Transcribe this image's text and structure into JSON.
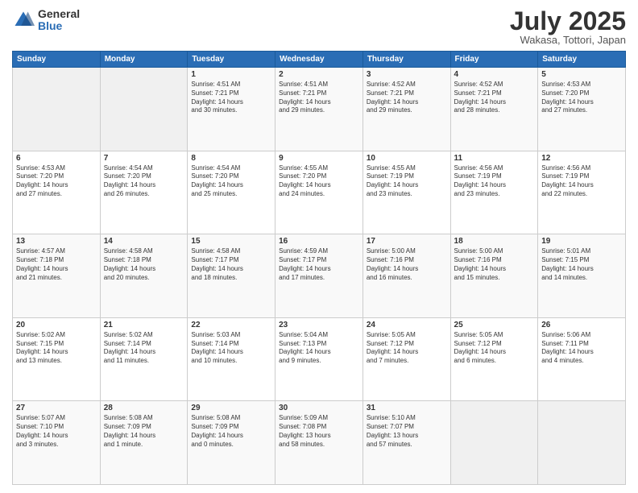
{
  "header": {
    "logo_general": "General",
    "logo_blue": "Blue",
    "month_title": "July 2025",
    "location": "Wakasa, Tottori, Japan"
  },
  "weekdays": [
    "Sunday",
    "Monday",
    "Tuesday",
    "Wednesday",
    "Thursday",
    "Friday",
    "Saturday"
  ],
  "weeks": [
    [
      {
        "day": "",
        "info": ""
      },
      {
        "day": "",
        "info": ""
      },
      {
        "day": "1",
        "info": "Sunrise: 4:51 AM\nSunset: 7:21 PM\nDaylight: 14 hours\nand 30 minutes."
      },
      {
        "day": "2",
        "info": "Sunrise: 4:51 AM\nSunset: 7:21 PM\nDaylight: 14 hours\nand 29 minutes."
      },
      {
        "day": "3",
        "info": "Sunrise: 4:52 AM\nSunset: 7:21 PM\nDaylight: 14 hours\nand 29 minutes."
      },
      {
        "day": "4",
        "info": "Sunrise: 4:52 AM\nSunset: 7:21 PM\nDaylight: 14 hours\nand 28 minutes."
      },
      {
        "day": "5",
        "info": "Sunrise: 4:53 AM\nSunset: 7:20 PM\nDaylight: 14 hours\nand 27 minutes."
      }
    ],
    [
      {
        "day": "6",
        "info": "Sunrise: 4:53 AM\nSunset: 7:20 PM\nDaylight: 14 hours\nand 27 minutes."
      },
      {
        "day": "7",
        "info": "Sunrise: 4:54 AM\nSunset: 7:20 PM\nDaylight: 14 hours\nand 26 minutes."
      },
      {
        "day": "8",
        "info": "Sunrise: 4:54 AM\nSunset: 7:20 PM\nDaylight: 14 hours\nand 25 minutes."
      },
      {
        "day": "9",
        "info": "Sunrise: 4:55 AM\nSunset: 7:20 PM\nDaylight: 14 hours\nand 24 minutes."
      },
      {
        "day": "10",
        "info": "Sunrise: 4:55 AM\nSunset: 7:19 PM\nDaylight: 14 hours\nand 23 minutes."
      },
      {
        "day": "11",
        "info": "Sunrise: 4:56 AM\nSunset: 7:19 PM\nDaylight: 14 hours\nand 23 minutes."
      },
      {
        "day": "12",
        "info": "Sunrise: 4:56 AM\nSunset: 7:19 PM\nDaylight: 14 hours\nand 22 minutes."
      }
    ],
    [
      {
        "day": "13",
        "info": "Sunrise: 4:57 AM\nSunset: 7:18 PM\nDaylight: 14 hours\nand 21 minutes."
      },
      {
        "day": "14",
        "info": "Sunrise: 4:58 AM\nSunset: 7:18 PM\nDaylight: 14 hours\nand 20 minutes."
      },
      {
        "day": "15",
        "info": "Sunrise: 4:58 AM\nSunset: 7:17 PM\nDaylight: 14 hours\nand 18 minutes."
      },
      {
        "day": "16",
        "info": "Sunrise: 4:59 AM\nSunset: 7:17 PM\nDaylight: 14 hours\nand 17 minutes."
      },
      {
        "day": "17",
        "info": "Sunrise: 5:00 AM\nSunset: 7:16 PM\nDaylight: 14 hours\nand 16 minutes."
      },
      {
        "day": "18",
        "info": "Sunrise: 5:00 AM\nSunset: 7:16 PM\nDaylight: 14 hours\nand 15 minutes."
      },
      {
        "day": "19",
        "info": "Sunrise: 5:01 AM\nSunset: 7:15 PM\nDaylight: 14 hours\nand 14 minutes."
      }
    ],
    [
      {
        "day": "20",
        "info": "Sunrise: 5:02 AM\nSunset: 7:15 PM\nDaylight: 14 hours\nand 13 minutes."
      },
      {
        "day": "21",
        "info": "Sunrise: 5:02 AM\nSunset: 7:14 PM\nDaylight: 14 hours\nand 11 minutes."
      },
      {
        "day": "22",
        "info": "Sunrise: 5:03 AM\nSunset: 7:14 PM\nDaylight: 14 hours\nand 10 minutes."
      },
      {
        "day": "23",
        "info": "Sunrise: 5:04 AM\nSunset: 7:13 PM\nDaylight: 14 hours\nand 9 minutes."
      },
      {
        "day": "24",
        "info": "Sunrise: 5:05 AM\nSunset: 7:12 PM\nDaylight: 14 hours\nand 7 minutes."
      },
      {
        "day": "25",
        "info": "Sunrise: 5:05 AM\nSunset: 7:12 PM\nDaylight: 14 hours\nand 6 minutes."
      },
      {
        "day": "26",
        "info": "Sunrise: 5:06 AM\nSunset: 7:11 PM\nDaylight: 14 hours\nand 4 minutes."
      }
    ],
    [
      {
        "day": "27",
        "info": "Sunrise: 5:07 AM\nSunset: 7:10 PM\nDaylight: 14 hours\nand 3 minutes."
      },
      {
        "day": "28",
        "info": "Sunrise: 5:08 AM\nSunset: 7:09 PM\nDaylight: 14 hours\nand 1 minute."
      },
      {
        "day": "29",
        "info": "Sunrise: 5:08 AM\nSunset: 7:09 PM\nDaylight: 14 hours\nand 0 minutes."
      },
      {
        "day": "30",
        "info": "Sunrise: 5:09 AM\nSunset: 7:08 PM\nDaylight: 13 hours\nand 58 minutes."
      },
      {
        "day": "31",
        "info": "Sunrise: 5:10 AM\nSunset: 7:07 PM\nDaylight: 13 hours\nand 57 minutes."
      },
      {
        "day": "",
        "info": ""
      },
      {
        "day": "",
        "info": ""
      }
    ]
  ]
}
